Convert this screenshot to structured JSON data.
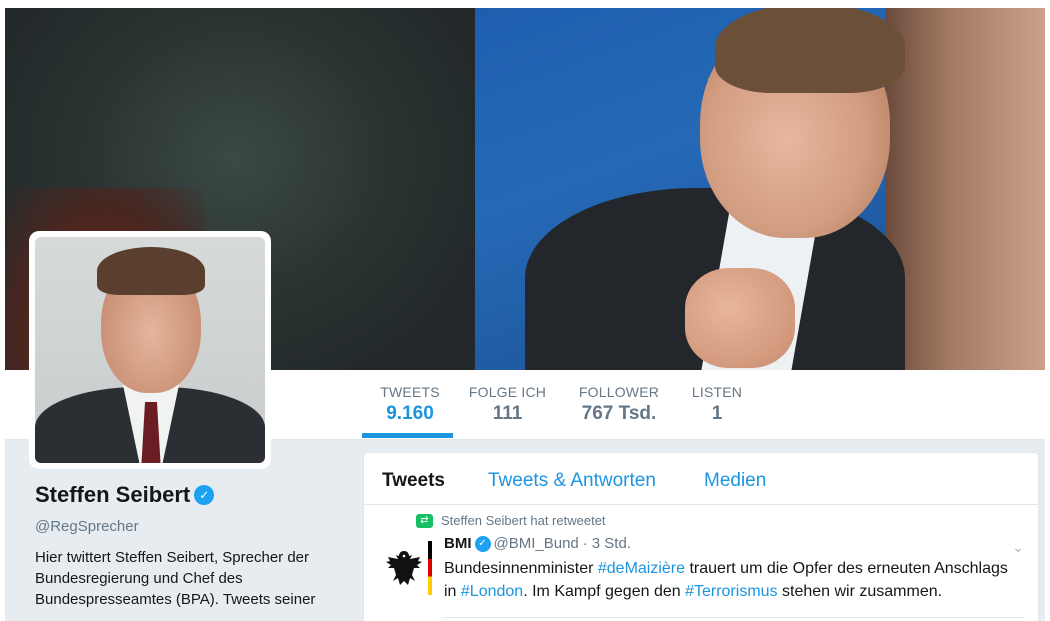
{
  "profile": {
    "name": "Steffen Seibert",
    "handle": "@RegSprecher",
    "bio": "Hier twittert Steffen Seibert, Sprecher der Bundesregierung und Chef des Bundespresseamtes (BPA). Tweets seiner"
  },
  "nav": {
    "stats": [
      {
        "label": "TWEETS",
        "value": "9.160"
      },
      {
        "label": "FOLGE ICH",
        "value": "111"
      },
      {
        "label": "FOLLOWER",
        "value": "767 Tsd."
      },
      {
        "label": "LISTEN",
        "value": "1"
      }
    ],
    "active": "TWEETS"
  },
  "timeline": {
    "tabs": [
      "Tweets",
      "Tweets & Antworten",
      "Medien"
    ],
    "tweet": {
      "retweet_context": "Steffen Seibert hat retweetet",
      "author": "BMI",
      "handle": "@BMI_Bund",
      "separator": "·",
      "time": "3 Std.",
      "text_parts": [
        "Bundesinnenminister ",
        "#deMaizière",
        " trauert um die Opfer des erneuten Anschlags in ",
        "#London",
        ". Im Kampf gegen den ",
        "#Terrorismus",
        " stehen wir zusammen."
      ]
    }
  },
  "icons": {
    "verified": "verified-badge-icon",
    "retweet": "retweet-icon",
    "menu": "chevron-down-icon",
    "avatar": "federal-eagle-icon"
  },
  "colors": {
    "accent": "#1b95e0",
    "verified": "#1da1f2",
    "retweet": "#17bf63",
    "muted": "#657786"
  }
}
